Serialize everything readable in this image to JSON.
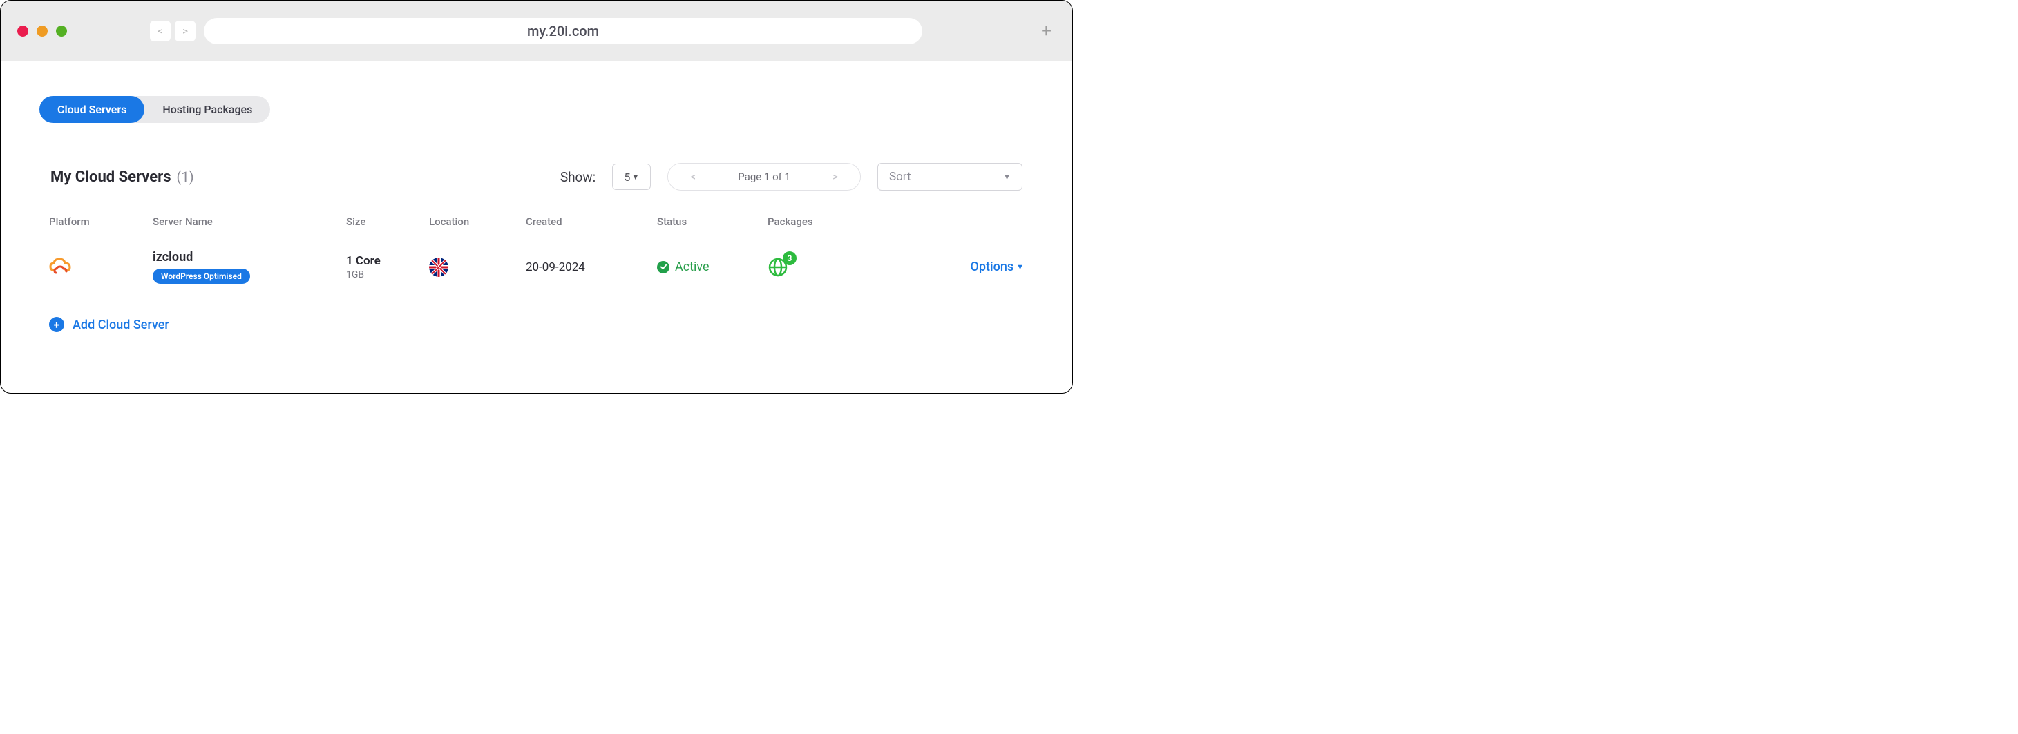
{
  "browser": {
    "url": "my.20i.com",
    "back": "<",
    "forward": ">",
    "plus": "+"
  },
  "tabs": {
    "cloud": "Cloud Servers",
    "hosting": "Hosting Packages"
  },
  "header": {
    "title": "My Cloud Servers",
    "count": "(1)"
  },
  "controls": {
    "show_label": "Show:",
    "show_value": "5",
    "page_prev": "<",
    "page_label": "Page 1 of  1",
    "page_next": ">",
    "sort_label": "Sort"
  },
  "columns": {
    "platform": "Platform",
    "server_name": "Server Name",
    "size": "Size",
    "location": "Location",
    "created": "Created",
    "status": "Status",
    "packages": "Packages"
  },
  "row": {
    "server_name": "izcloud",
    "badge": "WordPress Optimised",
    "size_cores": "1 Core",
    "size_mem": "1GB",
    "location": "UK",
    "created": "20-09-2024",
    "status": "Active",
    "package_count": "3",
    "options": "Options"
  },
  "add": {
    "label": "Add Cloud Server"
  }
}
